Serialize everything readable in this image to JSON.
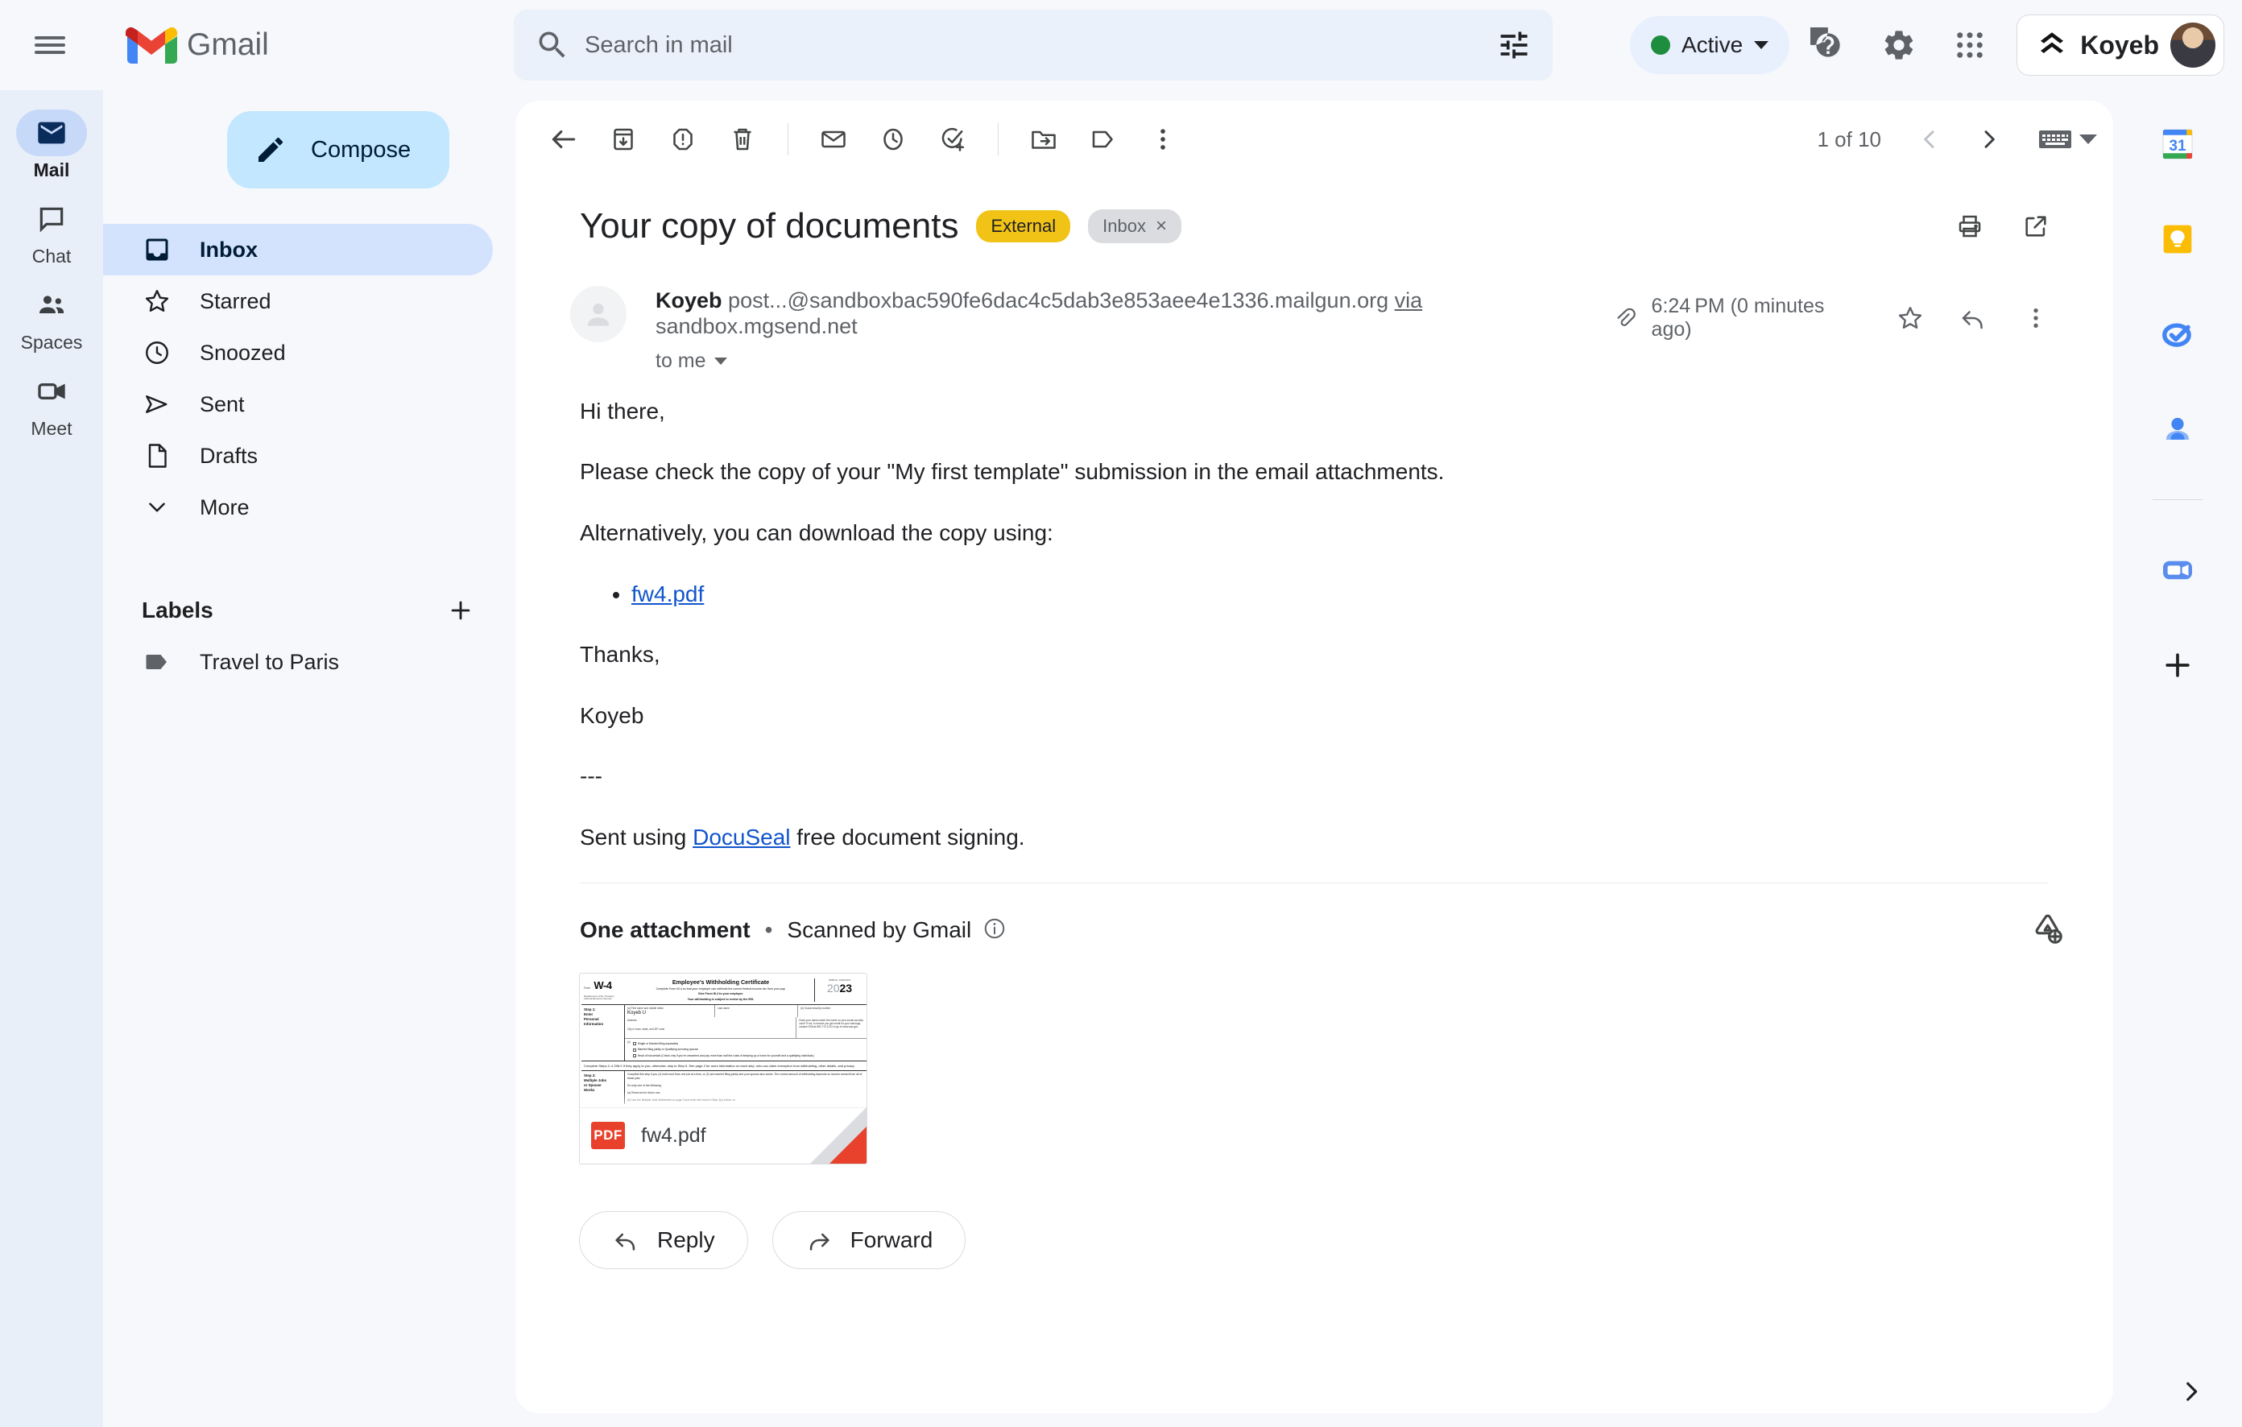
{
  "app": {
    "name": "Gmail",
    "hamburger_label": "Main menu"
  },
  "search": {
    "placeholder": "Search in mail",
    "value": "",
    "search_icon": "search-icon",
    "filter_icon": "tune-filter-icon"
  },
  "topbar": {
    "status_label": "Active",
    "status_color": "#1e8e3e",
    "help_icon": "help-circle-icon",
    "settings_icon": "gear-icon",
    "apps_icon": "grid-apps-icon",
    "account_name": "Koyeb",
    "account_avatar": "user-photo-avatar"
  },
  "rail": {
    "items": [
      {
        "label": "Mail",
        "icon": "mail-icon",
        "active": true
      },
      {
        "label": "Chat",
        "icon": "chat-bubble-icon",
        "active": false
      },
      {
        "label": "Spaces",
        "icon": "people-group-icon",
        "active": false
      },
      {
        "label": "Meet",
        "icon": "video-camera-icon",
        "active": false
      }
    ]
  },
  "sidebar": {
    "compose_label": "Compose",
    "compose_icon": "pencil-icon",
    "items": [
      {
        "label": "Inbox",
        "icon": "inbox-icon",
        "active": true
      },
      {
        "label": "Starred",
        "icon": "star-icon",
        "active": false
      },
      {
        "label": "Snoozed",
        "icon": "clock-icon",
        "active": false
      },
      {
        "label": "Sent",
        "icon": "send-paper-plane-icon",
        "active": false
      },
      {
        "label": "Drafts",
        "icon": "document-icon",
        "active": false
      },
      {
        "label": "More",
        "icon": "chevron-down-icon",
        "active": false
      }
    ],
    "labels_title": "Labels",
    "add_label_icon": "plus-icon",
    "labels": [
      {
        "label": "Travel to Paris",
        "icon": "label-tag-icon"
      }
    ]
  },
  "toolbar": {
    "back_icon": "arrow-left-icon",
    "archive_icon": "archive-icon",
    "spam_icon": "report-spam-icon",
    "delete_icon": "trash-icon",
    "mark_unread_icon": "envelope-icon",
    "snooze_icon": "clock-icon",
    "add_task_icon": "add-to-tasks-icon",
    "move_icon": "move-to-folder-icon",
    "label_icon": "label-tag-icon",
    "more_icon": "more-vertical-icon",
    "pager_text": "1 of 10",
    "prev_icon": "chevron-left-icon",
    "next_icon": "chevron-right-icon",
    "keyboard_icon": "keyboard-icon",
    "keyboard_caret_icon": "caret-down-icon"
  },
  "email": {
    "subject": "Your copy of documents",
    "chips": [
      {
        "label": "External",
        "type": "external",
        "color": "#f2c317"
      },
      {
        "label": "Inbox",
        "type": "inbox",
        "removable": true,
        "remove_glyph": "×"
      }
    ],
    "print_icon": "print-icon",
    "popout_icon": "open-in-new-icon",
    "sender_name": "Koyeb",
    "sender_address": "post...@sandboxbac590fe6dac4c5dab3e853aee4e1336.mailgun.org",
    "via_word": "via",
    "via_domain": "sandbox.mgsend.net",
    "to_line": "to me",
    "attachment_clip_icon": "paperclip-icon",
    "time": "6:24 PM (0 minutes ago)",
    "star_icon": "star-outline-icon",
    "reply_icon": "reply-arrow-icon",
    "more_icon": "more-vertical-icon",
    "body": {
      "greeting": "Hi there,",
      "para1": "Please check the copy of your \"My first template\" submission in the email attachments.",
      "para2": "Alternatively, you can download the copy using:",
      "links": [
        "fw4.pdf"
      ],
      "thanks": "Thanks,",
      "signature": "Koyeb",
      "dashes": "---",
      "footer_prefix": "Sent using ",
      "footer_link": "DocuSeal",
      "footer_suffix": " free document signing."
    }
  },
  "attachments": {
    "title": "One attachment",
    "separator": "•",
    "scanned_text": "Scanned by Gmail",
    "info_icon": "info-circle-icon",
    "add_all_to_drive_icon": "add-to-drive-icon",
    "files": [
      {
        "name": "fw4.pdf",
        "type_badge": "PDF",
        "preview": {
          "form_label": "Form",
          "form_number": "W-4",
          "dept_line1": "Department of the Treasury",
          "dept_line2": "Internal Revenue Service",
          "title": "Employee's Withholding Certificate",
          "sub1": "Complete Form W-4 so that your employer can withhold the correct federal income tax from your pay.",
          "sub2": "Give Form W-4 to your employer.",
          "sub3": "Your withholding is subject to review by the IRS.",
          "omb": "OMB No. 1545-0074",
          "year_prefix": "20",
          "year": "23",
          "step1_label": "Step 1:",
          "step1_label2": "Enter",
          "step1_label3": "Personal",
          "step1_label4": "Information",
          "field_a": "(a)  First name and middle initial",
          "field_a_value": "Koyeb U",
          "field_last": "Last name",
          "field_b": "(b)  Social security number",
          "field_address": "Address",
          "field_city": "City or town, state, and ZIP code",
          "ssn_note": "Does your name match the name on your social security card? If not, to ensure you get credit for your earnings, contact SSA at 800-772-1213 or go to www.ssa.gov.",
          "check_c": "(c)",
          "check1": "Single or Married filing separately",
          "check2": "Married filing jointly or Qualifying surviving spouse",
          "check3": "Head of household (Check only if you're unmarried and pay more than half the costs of keeping up a home for yourself and a qualifying individual.)",
          "note": "Complete Steps 2–4 ONLY if they apply to you; otherwise, skip to Step 5. See page 2 for more information on each step, who can claim exemption from withholding, other details, and privacy.",
          "step2_label": "Step 2:",
          "step2_label2": "Multiple Jobs",
          "step2_label3": "or Spouse",
          "step2_label4": "Works",
          "step2_text1": "Complete this step if you (1) hold more than one job at a time, or (2) are married filing jointly and your spouse also works. The correct amount of withholding depends on income earned from all of these jobs.",
          "step2_text2": "Do only one of the following.",
          "step2_a": "(a)  Reserved for future use.",
          "step2_b": "(b)  Use the Multiple Jobs Worksheet on page 3 and enter the result in Step 4(c) below; or"
        }
      }
    ]
  },
  "actions": {
    "reply_label": "Reply",
    "reply_icon": "reply-arrow-icon",
    "forward_label": "Forward",
    "forward_icon": "forward-arrow-icon"
  },
  "apps_rail": {
    "items": [
      {
        "name": "calendar-icon",
        "day": "31"
      },
      {
        "name": "keep-icon"
      },
      {
        "name": "tasks-icon"
      },
      {
        "name": "contacts-icon"
      },
      {
        "name": "meet-icon"
      },
      {
        "name": "add-apps-icon"
      }
    ],
    "expand_icon": "chevron-right-icon"
  }
}
